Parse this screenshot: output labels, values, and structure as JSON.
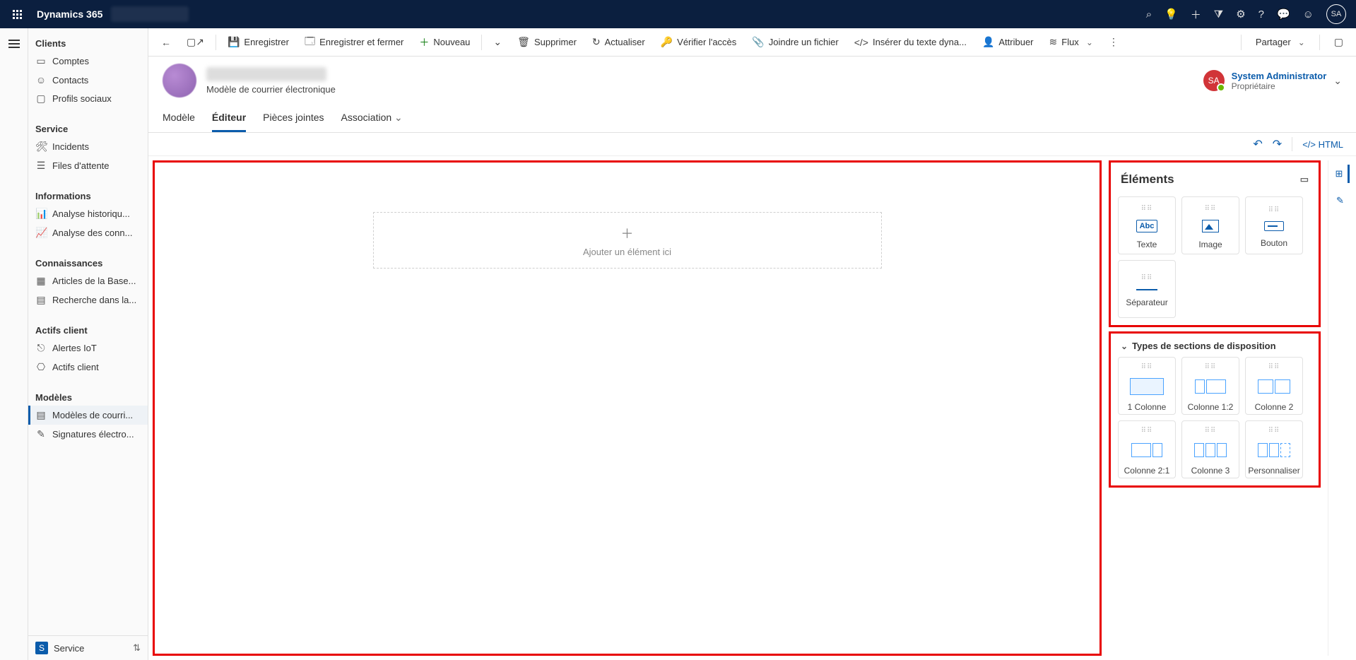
{
  "brand": "Dynamics 365",
  "avatar_initials": "SA",
  "cmd": {
    "save": "Enregistrer",
    "save_close": "Enregistrer et fermer",
    "new": "Nouveau",
    "delete": "Supprimer",
    "refresh": "Actualiser",
    "check_access": "Vérifier l'accès",
    "attach": "Joindre un fichier",
    "insert_dyn": "Insérer du texte dyna...",
    "assign": "Attribuer",
    "flow": "Flux",
    "share": "Partager"
  },
  "record": {
    "subtitle": "Modèle de courrier électronique",
    "owner_name": "System Administrator",
    "owner_role": "Propriétaire"
  },
  "tabs": {
    "model": "Modèle",
    "editor": "Éditeur",
    "attachments": "Pièces jointes",
    "association": "Association"
  },
  "toolbar_html": "HTML",
  "canvas": {
    "placeholder": "Ajouter un élément ici"
  },
  "elements_panel": {
    "title": "Éléments",
    "text": "Texte",
    "image": "Image",
    "button": "Bouton",
    "divider": "Séparateur"
  },
  "layouts_panel": {
    "title": "Types de sections de disposition",
    "col1": "1 Colonne",
    "col12": "Colonne 1:2",
    "col2": "Colonne 2",
    "col21": "Colonne 2:1",
    "col3": "Colonne 3",
    "custom": "Personnaliser"
  },
  "nav": {
    "clients": {
      "title": "Clients",
      "items": [
        "Comptes",
        "Contacts",
        "Profils sociaux"
      ]
    },
    "service": {
      "title": "Service",
      "items": [
        "Incidents",
        "Files d'attente"
      ]
    },
    "infos": {
      "title": "Informations",
      "items": [
        "Analyse historiqu...",
        "Analyse des conn..."
      ]
    },
    "knowledge": {
      "title": "Connaissances",
      "items": [
        "Articles de la Base...",
        "Recherche dans la..."
      ]
    },
    "assets": {
      "title": "Actifs client",
      "items": [
        "Alertes IoT",
        "Actifs client"
      ]
    },
    "models": {
      "title": "Modèles",
      "items": [
        "Modèles de courri...",
        "Signatures électro..."
      ]
    },
    "area": "Service"
  }
}
